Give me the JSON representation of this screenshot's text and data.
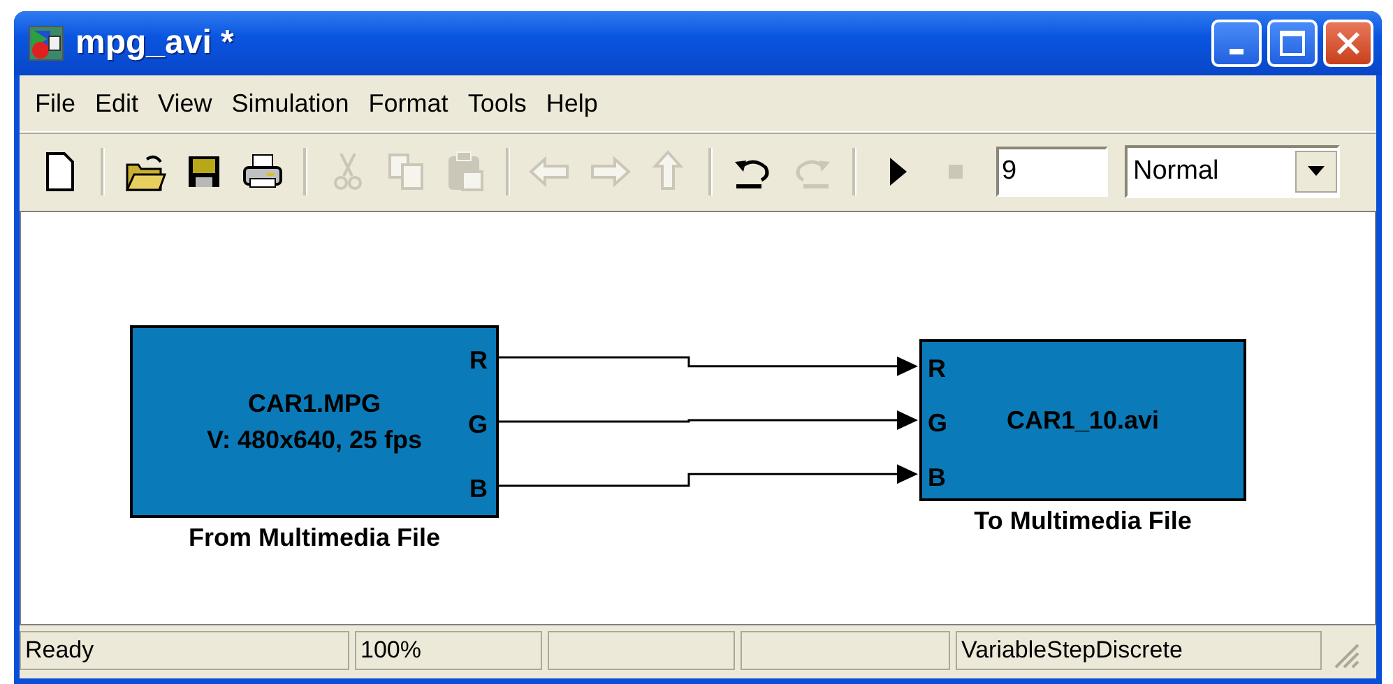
{
  "window": {
    "title": "mpg_avi *"
  },
  "menu": [
    {
      "label": "File"
    },
    {
      "label": "Edit"
    },
    {
      "label": "View"
    },
    {
      "label": "Simulation"
    },
    {
      "label": "Format"
    },
    {
      "label": "Tools"
    },
    {
      "label": "Help"
    }
  ],
  "toolbar": [
    {
      "kind": "button",
      "disabled": false
    },
    {
      "kind": "separator"
    },
    {
      "kind": "button",
      "disabled": false
    },
    {
      "kind": "button",
      "disabled": false
    },
    {
      "kind": "button",
      "disabled": false
    },
    {
      "kind": "separator"
    },
    {
      "kind": "button",
      "disabled": true
    },
    {
      "kind": "button",
      "disabled": true
    },
    {
      "kind": "button",
      "disabled": true
    },
    {
      "kind": "separator"
    },
    {
      "kind": "button",
      "disabled": true
    },
    {
      "kind": "button",
      "disabled": true
    },
    {
      "kind": "button",
      "disabled": true
    },
    {
      "kind": "separator"
    },
    {
      "kind": "button",
      "disabled": false
    },
    {
      "kind": "button",
      "disabled": true
    },
    {
      "kind": "separator"
    },
    {
      "kind": "button",
      "disabled": false
    },
    {
      "kind": "button",
      "disabled": true
    }
  ],
  "stop_time": {
    "value": "9"
  },
  "sim_mode": {
    "value": "Normal"
  },
  "blocks": [
    {
      "lines": [
        "CAR1.MPG",
        "V: 480x640, 25 fps"
      ],
      "outputs": [
        "R",
        "G",
        "B"
      ],
      "caption": "From Multimedia File"
    },
    {
      "lines": [
        "CAR1_10.avi"
      ],
      "inputs": [
        "R",
        "G",
        "B"
      ],
      "caption": "To Multimedia File"
    }
  ],
  "status_bar": {
    "status": "Ready",
    "zoom": "100%",
    "solver": "VariableStepDiscrete"
  }
}
